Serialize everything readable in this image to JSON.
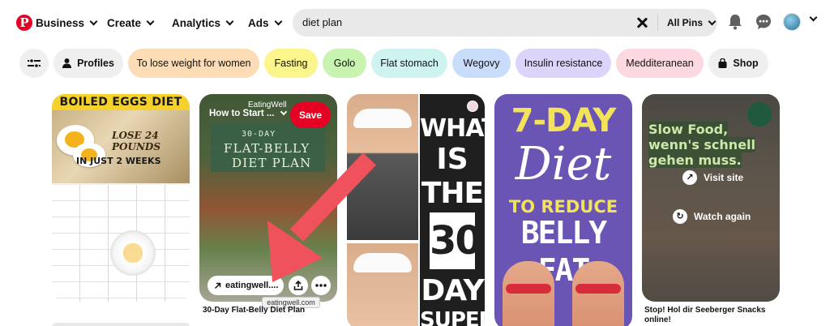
{
  "header": {
    "nav": [
      {
        "label": "Business"
      },
      {
        "label": "Create"
      },
      {
        "label": "Analytics"
      },
      {
        "label": "Ads"
      }
    ],
    "search": {
      "value": "diet plan",
      "scope": "All Pins"
    }
  },
  "chips": [
    {
      "label": "",
      "icon": "filter-icon",
      "color": "#efefef"
    },
    {
      "label": "Profiles",
      "icon": "person-icon",
      "color": "#efefef"
    },
    {
      "label": "To lose weight for women",
      "color": "#fbdcb4"
    },
    {
      "label": "Fasting",
      "color": "#fbf58b"
    },
    {
      "label": "Golo",
      "color": "#c9f3b1"
    },
    {
      "label": "Flat stomach",
      "color": "#cff4ef"
    },
    {
      "label": "Wegovy",
      "color": "#c9ddfa"
    },
    {
      "label": "Insulin resistance",
      "color": "#ddd4fa"
    },
    {
      "label": "Medditeranean",
      "color": "#fcd9e0"
    },
    {
      "label": "Shop",
      "icon": "shopping-bag-icon",
      "color": "#efefef"
    }
  ],
  "pins": {
    "boiled_eggs": {
      "banner": "BOILED EGGS DIET",
      "lose": "LOSE 24 POUNDS",
      "weeks": "IN JUST 2 WEEKS"
    },
    "flat_belly": {
      "brand": "EatingWell",
      "title_1": "30-DAY",
      "title_2": "FLAT-BELLY",
      "title_3": "DIET PLAN",
      "board": "How to Start ...",
      "save": "Save",
      "link": "eatingwell....",
      "tooltip": "eatingwell.com",
      "caption": "30-Day Flat-Belly Diet Plan"
    },
    "thirty_day": {
      "what": "WHAT",
      "is": "IS",
      "the": "THE",
      "num": "30",
      "day": "DAY",
      "super": "SUPER"
    },
    "seven_day": {
      "line1": "7-DAY",
      "line2": "Diet",
      "line3": "TO REDUCE",
      "line4": "BELLY FAT"
    },
    "seeberger": {
      "headline": "Slow Food, wenn's schnell gehen muss.",
      "visit": "Visit site",
      "watch": "Watch again",
      "caption": "Stop! Hol dir Seeberger Snacks online!"
    }
  },
  "colors": {
    "brand": "#e60023",
    "save": "#e60023",
    "arrow": "#f0525c"
  }
}
